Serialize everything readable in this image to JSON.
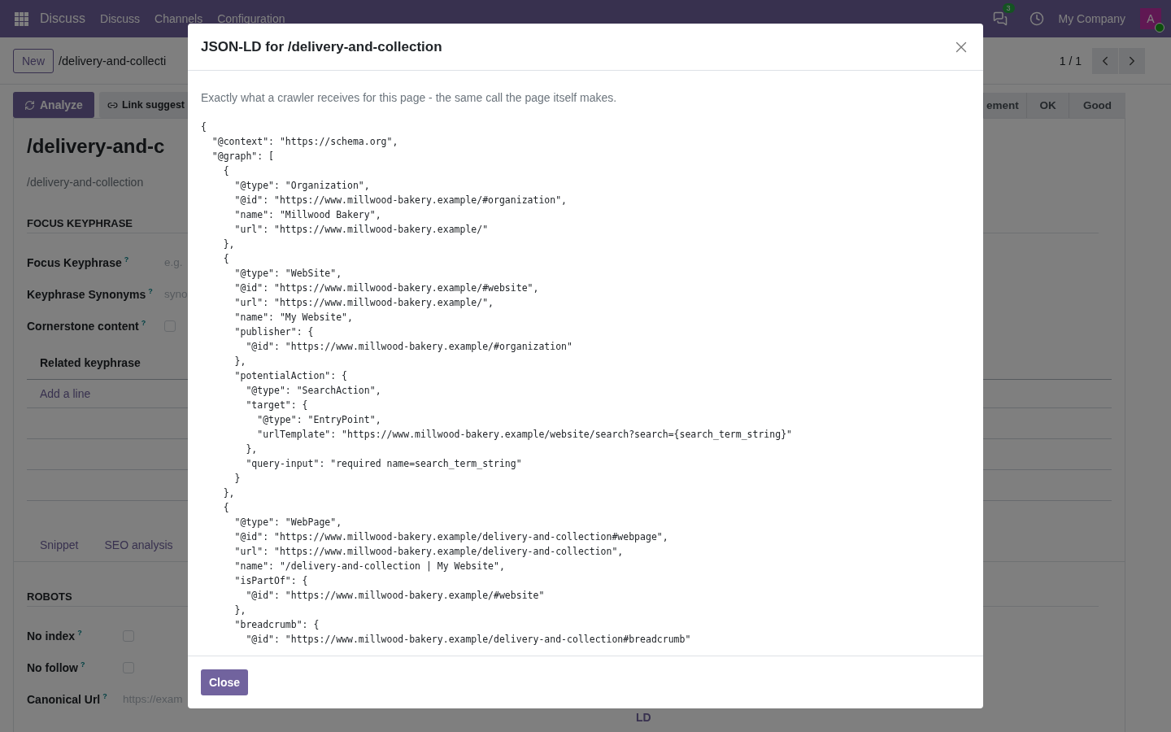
{
  "navbar": {
    "app_name": "Discuss",
    "menu": [
      "Discuss",
      "Channels",
      "Configuration"
    ],
    "chat_badge": "3",
    "company": "My Company",
    "avatar": "A"
  },
  "control_panel": {
    "new_button": "New",
    "breadcrumb": "/delivery-and-collecti",
    "pager": "1 / 1"
  },
  "actions": {
    "analyze": "Analyze",
    "link_suggest": "Link suggest",
    "status_steps": [
      {
        "label": "ement",
        "selected": false
      },
      {
        "label": "OK",
        "selected": false
      },
      {
        "label": "Good",
        "selected": false
      }
    ]
  },
  "record": {
    "title": "/delivery-and-c",
    "subtitle": "/delivery-and-collection",
    "focus_section": "FOCUS KEYPHRASE",
    "fields": [
      {
        "kind": "input",
        "label": "Focus Keyphrase",
        "help": "?",
        "placeholder": "e.g."
      },
      {
        "kind": "input",
        "label": "Keyphrase Synonyms",
        "help": "?",
        "placeholder": "syno"
      },
      {
        "kind": "checkbox",
        "label": "Cornerstone content",
        "help": "?",
        "checked": false
      }
    ],
    "related_table": {
      "column": "Related keyphrase",
      "add_line": "Add a line"
    },
    "tabs": [
      {
        "label": "Snippet",
        "selected": false
      },
      {
        "label": "SEO analysis",
        "selected": false
      }
    ],
    "robots_section": "ROBOTS",
    "robot_fields": [
      {
        "kind": "checkbox",
        "label": "No index",
        "help": "?",
        "checked": false
      },
      {
        "kind": "checkbox",
        "label": "No follow",
        "help": "?",
        "checked": false
      },
      {
        "kind": "input",
        "label": "Canonical Url",
        "help": "?",
        "placeholder": "https://exam"
      }
    ],
    "bottom_tab": "LD"
  },
  "dialog": {
    "title": "JSON-LD for /delivery-and-collection",
    "description": "Exactly what a crawler receives for this page - the same call the page itself makes.",
    "code_lines": [
      "{",
      "  \"@context\": \"https://schema.org\",",
      "  \"@graph\": [",
      "    {",
      "      \"@type\": \"Organization\",",
      "      \"@id\": \"https://www.millwood-bakery.example/#organization\",",
      "      \"name\": \"Millwood Bakery\",",
      "      \"url\": \"https://www.millwood-bakery.example/\"",
      "    },",
      "    {",
      "      \"@type\": \"WebSite\",",
      "      \"@id\": \"https://www.millwood-bakery.example/#website\",",
      "      \"url\": \"https://www.millwood-bakery.example/\",",
      "      \"name\": \"My Website\",",
      "      \"publisher\": {",
      "        \"@id\": \"https://www.millwood-bakery.example/#organization\"",
      "      },",
      "      \"potentialAction\": {",
      "        \"@type\": \"SearchAction\",",
      "        \"target\": {",
      "          \"@type\": \"EntryPoint\",",
      "          \"urlTemplate\": \"https://www.millwood-bakery.example/website/search?search={search_term_string}\"",
      "        },",
      "        \"query-input\": \"required name=search_term_string\"",
      "      }",
      "    },",
      "    {",
      "      \"@type\": \"WebPage\",",
      "      \"@id\": \"https://www.millwood-bakery.example/delivery-and-collection#webpage\",",
      "      \"url\": \"https://www.millwood-bakery.example/delivery-and-collection\",",
      "      \"name\": \"/delivery-and-collection | My Website\",",
      "      \"isPartOf\": {",
      "        \"@id\": \"https://www.millwood-bakery.example/#website\"",
      "      },",
      "      \"breadcrumb\": {",
      "        \"@id\": \"https://www.millwood-bakery.example/delivery-and-collection#breadcrumb\""
    ],
    "close_button": "Close"
  }
}
